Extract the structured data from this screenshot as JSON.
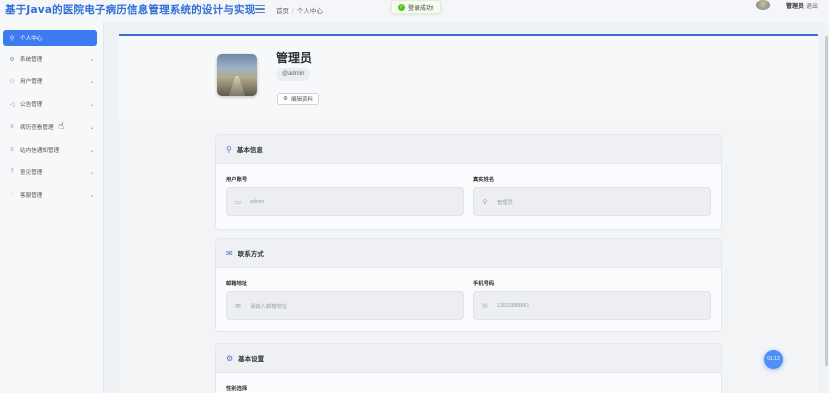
{
  "header": {
    "app_title": "基于Java的医院电子病历信息管理系统的设计与实现",
    "breadcrumb_home": "首页",
    "breadcrumb_sep": "/",
    "breadcrumb_current": "个人中心",
    "toast_text": "登录成功!",
    "user_name": "管理员",
    "logout_label": "退出"
  },
  "sidebar": {
    "items": [
      {
        "label": "个人中心",
        "icon": "user-icon",
        "active": true
      },
      {
        "label": "系统管理",
        "icon": "gear-icon"
      },
      {
        "label": "用户管理",
        "icon": "users-icon"
      },
      {
        "label": "公告管理",
        "icon": "megaphone-icon"
      },
      {
        "label": "病历查看管理",
        "icon": "list-icon"
      },
      {
        "label": "站内信通知管理",
        "icon": "list-icon"
      },
      {
        "label": "意见管理",
        "icon": "question-icon"
      },
      {
        "label": "客服管理",
        "icon": "chat-icon"
      }
    ]
  },
  "profile": {
    "name": "管理员",
    "handle": "@admin",
    "edit_label": "编辑资料"
  },
  "sections": {
    "basic": {
      "title": "基本信息",
      "account_label": "用户账号",
      "account_value": "admin",
      "realname_label": "真实姓名",
      "realname_value": "管理员"
    },
    "contact": {
      "title": "联系方式",
      "email_label": "邮箱地址",
      "email_placeholder": "请输入邮箱地址",
      "phone_label": "手机号码",
      "phone_value": "13823888881"
    },
    "settings": {
      "title": "基本设置",
      "gender_label": "性别选择"
    }
  },
  "time_badge": "01:12",
  "colors": {
    "accent": "#3d7cf0",
    "title": "#2f6fd6",
    "success": "#52c41a"
  }
}
